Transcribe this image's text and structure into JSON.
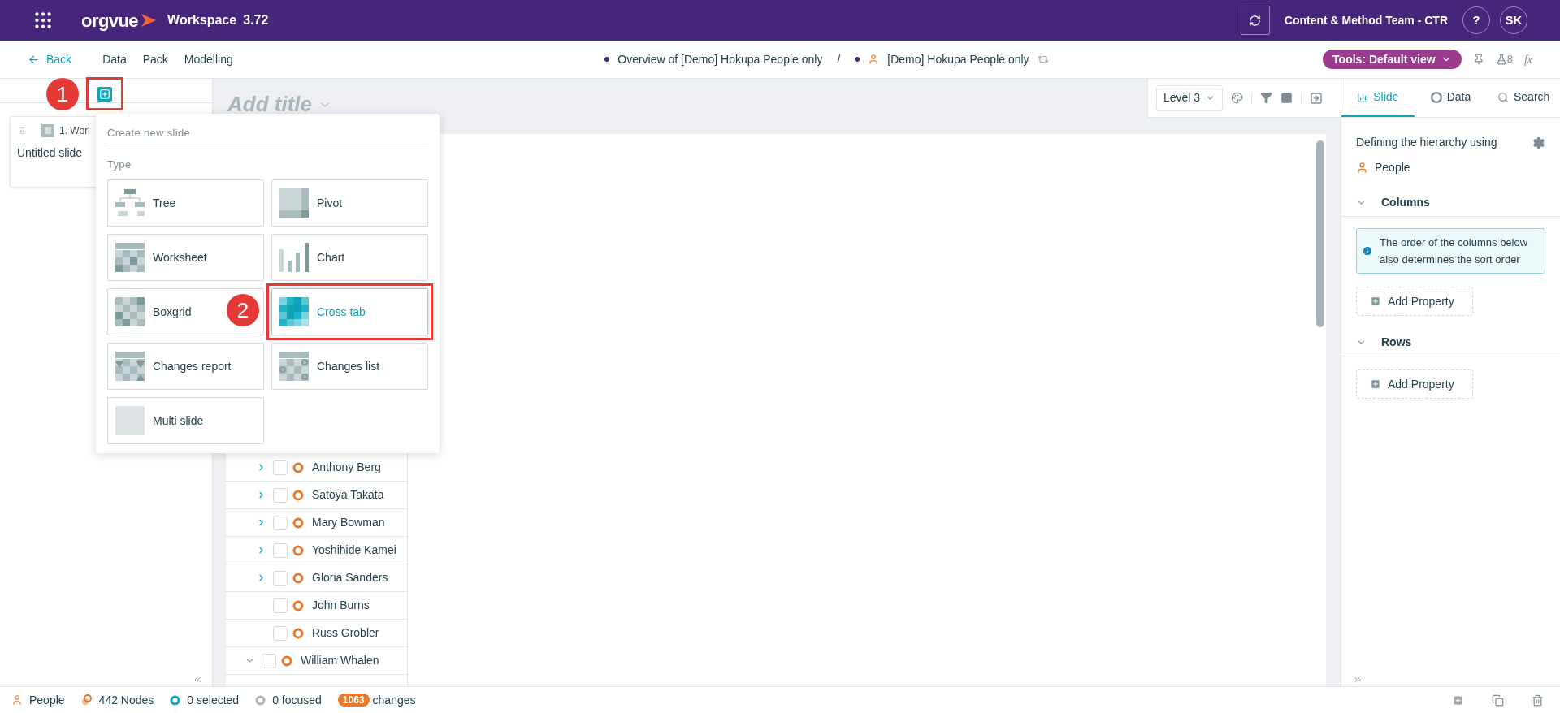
{
  "topbar": {
    "logo": "orgvue",
    "workspace": "Workspace",
    "version": "3.72",
    "team": "Content & Method Team - CTR",
    "help": "?",
    "user_initials": "SK"
  },
  "navbar": {
    "back": "Back",
    "menu": [
      "Data",
      "Pack",
      "Modelling"
    ],
    "breadcrumb": {
      "overview": "Overview of [Demo] Hokupa People only",
      "separator": "/",
      "dataset": "[Demo] Hokupa People only"
    },
    "tools": "Tools: Default view",
    "flask_count": "8",
    "fx": "fx"
  },
  "slides_panel": {
    "slides": [
      {
        "number": "1. Worl",
        "title": "Untitled slide"
      }
    ]
  },
  "new_slide_menu": {
    "title": "Create new slide",
    "section": "Type",
    "items": [
      {
        "kind": "tree",
        "label": "Tree",
        "selected": false
      },
      {
        "kind": "pivot",
        "label": "Pivot",
        "selected": false
      },
      {
        "kind": "worksheet",
        "label": "Worksheet",
        "selected": false
      },
      {
        "kind": "chart",
        "label": "Chart",
        "selected": false
      },
      {
        "kind": "boxgrid",
        "label": "Boxgrid",
        "selected": false
      },
      {
        "kind": "crosstab",
        "label": "Cross tab",
        "selected": true
      },
      {
        "kind": "changes_report",
        "label": "Changes report",
        "selected": false
      },
      {
        "kind": "changes_list",
        "label": "Changes list",
        "selected": false
      },
      {
        "kind": "multi",
        "label": "Multi slide",
        "selected": false
      }
    ]
  },
  "annotations": [
    {
      "label": "1"
    },
    {
      "label": "2"
    }
  ],
  "canvas": {
    "title_placeholder": "Add title",
    "level": "Level 3",
    "tree": [
      {
        "children": [
          {
            "name": "Anthony Berg",
            "expandable": true,
            "expanded": false,
            "checked": false
          },
          {
            "name": "Satoya Takata",
            "expandable": true,
            "expanded": false,
            "checked": false
          },
          {
            "name": "Mary Bowman",
            "expandable": true,
            "expanded": false,
            "checked": false
          },
          {
            "name": "Yoshihide Kamei",
            "expandable": true,
            "expanded": false,
            "checked": false
          },
          {
            "name": "Gloria Sanders",
            "expandable": true,
            "expanded": false,
            "checked": false
          },
          {
            "name": "John Burns",
            "expandable": false,
            "checked": false
          },
          {
            "name": "Russ Grobler",
            "expandable": false,
            "checked": false
          }
        ]
      },
      {
        "name": "William Whalen",
        "expandable": true,
        "expanded": true,
        "checked": false
      }
    ]
  },
  "side_panel": {
    "tabs": [
      {
        "kind": "slide",
        "label": "Slide",
        "selected": true
      },
      {
        "kind": "data",
        "label": "Data",
        "selected": false
      },
      {
        "kind": "search",
        "label": "Search",
        "selected": false
      }
    ],
    "hierarchy_label": "Defining the hierarchy using",
    "hierarchy_value": "People",
    "sections": [
      {
        "title": "Columns",
        "expanded": true,
        "info": "The order of the columns below also determines the sort order",
        "add": "Add Property"
      },
      {
        "title": "Rows",
        "expanded": true,
        "add": "Add Property"
      }
    ]
  },
  "status_bar": {
    "items": [
      {
        "kind": "person",
        "text": "People"
      },
      {
        "kind": "nodes",
        "text": "442 Nodes"
      },
      {
        "kind": "selected",
        "text": "0 selected"
      },
      {
        "kind": "focused",
        "text": "0 focused"
      }
    ],
    "changes_count": "1063",
    "changes_label": "changes"
  }
}
